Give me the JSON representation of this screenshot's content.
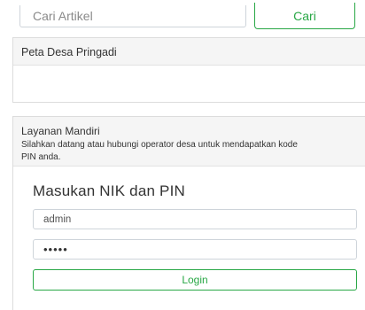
{
  "search": {
    "placeholder": "Cari Artikel",
    "button_label": "Cari"
  },
  "map_panel": {
    "title": "Peta Desa Pringadi"
  },
  "mandiri_panel": {
    "title": "Layanan Mandiri",
    "description": "Silahkan datang atau hubungi operator desa untuk mendapatkan kode PIN anda.",
    "form_title": "Masukan NIK dan PIN",
    "username_value": "admin",
    "pin_value": "•••••",
    "login_label": "Login"
  },
  "colors": {
    "accent_green": "#28a745",
    "panel_header_bg": "#f5f5f5"
  }
}
